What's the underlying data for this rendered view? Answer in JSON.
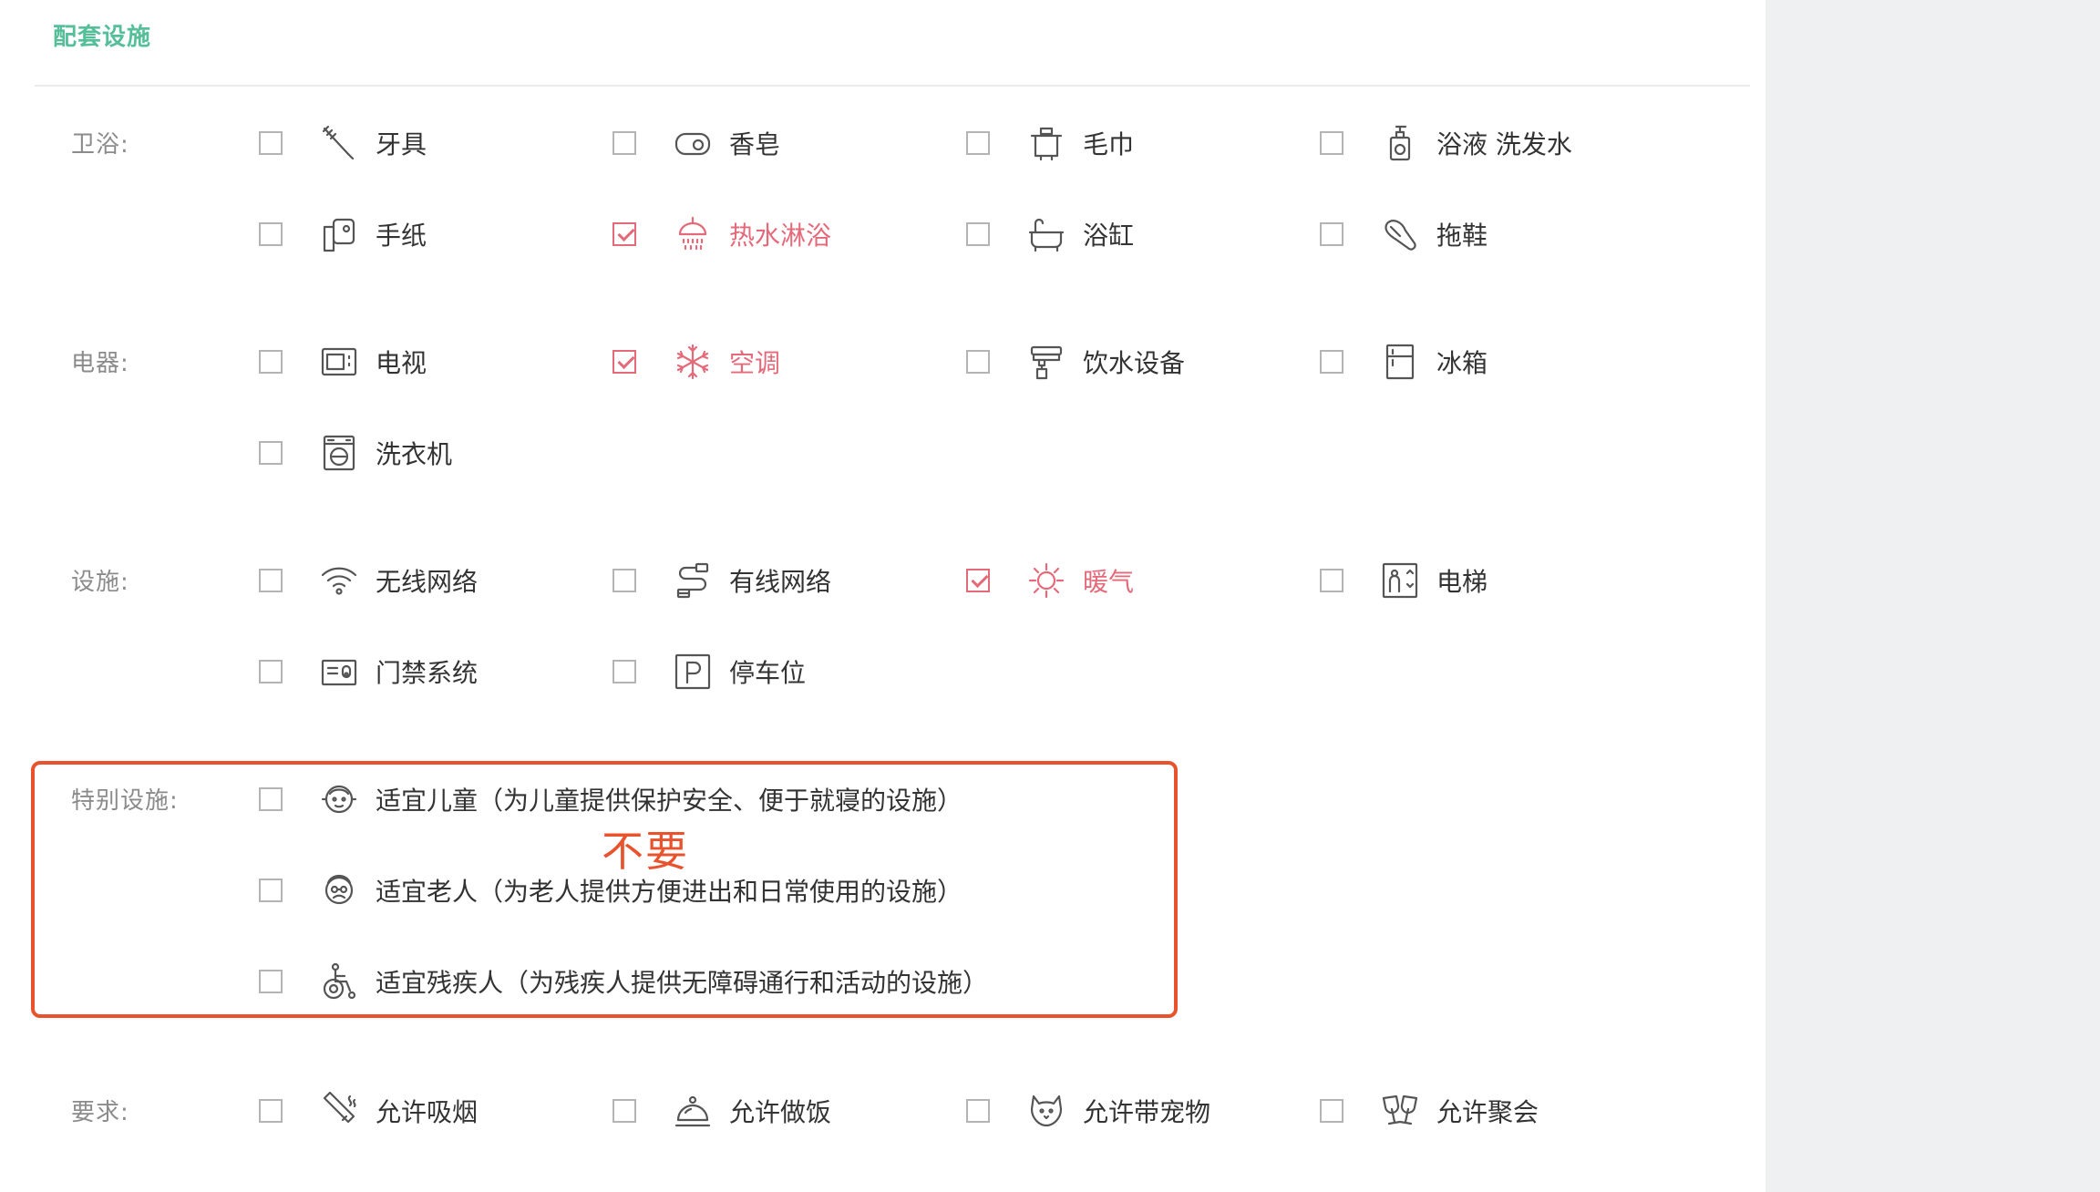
{
  "section_title": "配套设施",
  "colors": {
    "accent": "#55bf9a",
    "checked": "#e46a7a",
    "highlight": "#e8532e"
  },
  "annotation_note": "不要",
  "categories": [
    {
      "label": "卫浴:",
      "items": [
        {
          "label": "牙具",
          "icon": "toothbrush-icon",
          "checked": false
        },
        {
          "label": "香皂",
          "icon": "soap-icon",
          "checked": false
        },
        {
          "label": "毛巾",
          "icon": "towel-icon",
          "checked": false
        },
        {
          "label": "浴液 洗发水",
          "icon": "shampoo-icon",
          "checked": false
        },
        {
          "label": "手纸",
          "icon": "toilet-paper-icon",
          "checked": false
        },
        {
          "label": "热水淋浴",
          "icon": "shower-icon",
          "checked": true
        },
        {
          "label": "浴缸",
          "icon": "bathtub-icon",
          "checked": false
        },
        {
          "label": "拖鞋",
          "icon": "slipper-icon",
          "checked": false
        }
      ]
    },
    {
      "label": "电器:",
      "items": [
        {
          "label": "电视",
          "icon": "tv-icon",
          "checked": false
        },
        {
          "label": "空调",
          "icon": "air-conditioner-icon",
          "checked": true
        },
        {
          "label": "饮水设备",
          "icon": "water-dispenser-icon",
          "checked": false
        },
        {
          "label": "冰箱",
          "icon": "fridge-icon",
          "checked": false
        },
        {
          "label": "洗衣机",
          "icon": "washing-machine-icon",
          "checked": false
        }
      ]
    },
    {
      "label": "设施:",
      "items": [
        {
          "label": "无线网络",
          "icon": "wifi-icon",
          "checked": false
        },
        {
          "label": "有线网络",
          "icon": "ethernet-icon",
          "checked": false
        },
        {
          "label": "暖气",
          "icon": "heating-icon",
          "checked": true
        },
        {
          "label": "电梯",
          "icon": "elevator-icon",
          "checked": false
        },
        {
          "label": "门禁系统",
          "icon": "access-control-icon",
          "checked": false
        },
        {
          "label": "停车位",
          "icon": "parking-icon",
          "checked": false
        }
      ]
    },
    {
      "label": "特别设施:",
      "items": [
        {
          "label": "适宜儿童（为儿童提供保护安全、便于就寝的设施）",
          "icon": "child-icon",
          "checked": false
        },
        {
          "label": "适宜老人（为老人提供方便进出和日常使用的设施）",
          "icon": "elderly-icon",
          "checked": false
        },
        {
          "label": "适宜残疾人（为残疾人提供无障碍通行和活动的设施）",
          "icon": "wheelchair-icon",
          "checked": false
        }
      ]
    },
    {
      "label": "要求:",
      "items": [
        {
          "label": "允许吸烟",
          "icon": "smoking-icon",
          "checked": false
        },
        {
          "label": "允许做饭",
          "icon": "cooking-icon",
          "checked": false
        },
        {
          "label": "允许带宠物",
          "icon": "pet-icon",
          "checked": false
        },
        {
          "label": "允许聚会",
          "icon": "party-icon",
          "checked": false
        }
      ]
    }
  ]
}
